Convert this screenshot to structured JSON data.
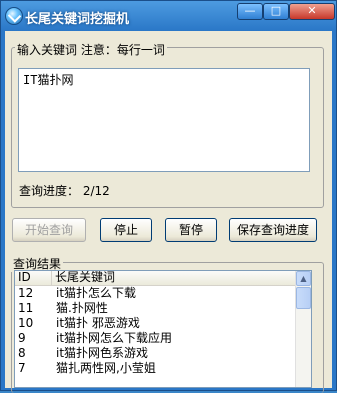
{
  "window": {
    "title": "长尾关键词挖掘机",
    "min_glyph": "—",
    "max_glyph": "□",
    "close_glyph": "✕"
  },
  "input_group": {
    "legend": "输入关键词 注意：每行一词",
    "textarea_value": "IT猫扑网",
    "progress_text": "查询进度： 2/12"
  },
  "buttons": {
    "start": "开始查询",
    "stop": "停止",
    "pause": "暂停",
    "save": "保存查询进度"
  },
  "results": {
    "legend": "查询结果",
    "columns": [
      "ID",
      "长尾关键词"
    ],
    "rows": [
      {
        "id": "12",
        "keyword": "it猫扑怎么下载"
      },
      {
        "id": "11",
        "keyword": "猫.扑网性"
      },
      {
        "id": "10",
        "keyword": "it猫扑 邪恶游戏"
      },
      {
        "id": "9",
        "keyword": "it猫扑网怎么下载应用"
      },
      {
        "id": "8",
        "keyword": "it猫扑网色系游戏"
      },
      {
        "id": "7",
        "keyword": "猫扎两性网,小莹姐"
      }
    ]
  },
  "colors": {
    "titlebar": "#2a77c7",
    "client_bg": "#ece9d8"
  }
}
